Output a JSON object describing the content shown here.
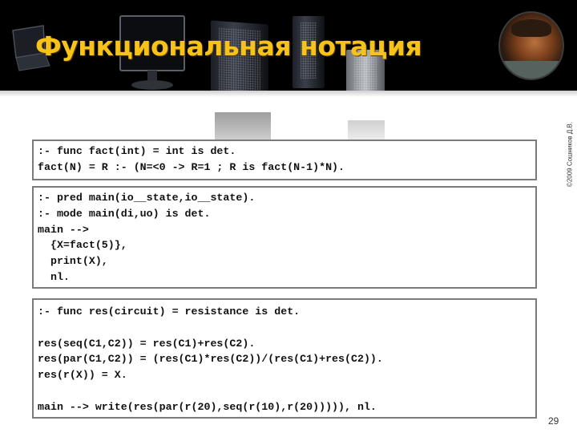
{
  "slide": {
    "title": "Функциональная нотация",
    "title_color": "#f7c31a",
    "copyright": "©2009 Сошников Д.В.",
    "page_number": "29"
  },
  "header": {
    "background_color": "#000000",
    "images": [
      "laptop",
      "monitor",
      "server-tower",
      "server-tower",
      "server-tower",
      "author-photo"
    ]
  },
  "code_blocks": [
    {
      "lines": [
        ":- func fact(int) = int is det.",
        "fact(N) = R :- (N=<0 -> R=1 ; R is fact(N-1)*N)."
      ]
    },
    {
      "lines": [
        ":- pred main(io__state,io__state).",
        ":- mode main(di,uo) is det.",
        "main -->",
        "  {X=fact(5)},",
        "  print(X),",
        "  nl."
      ]
    },
    {
      "lines": [
        ":- func res(circuit) = resistance is det.",
        "",
        "res(seq(C1,C2)) = res(C1)+res(C2).",
        "res(par(C1,C2)) = (res(C1)*res(C2))/(res(C1)+res(C2)).",
        "res(r(X)) = X.",
        "",
        "main --> write(res(par(r(20),seq(r(10),r(20))))), nl."
      ]
    }
  ]
}
